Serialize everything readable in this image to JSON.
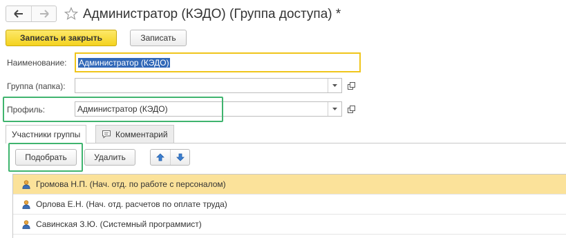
{
  "window": {
    "title": "Администратор (КЭДО) (Группа доступа) *"
  },
  "toolbar": {
    "save_close_label": "Записать и закрыть",
    "save_label": "Записать"
  },
  "form": {
    "name_label": "Наименование:",
    "name_value": "Администратор (КЭДО)",
    "group_label": "Группа (папка):",
    "group_value": "",
    "profile_label": "Профиль:",
    "profile_value": "Администратор (КЭДО)"
  },
  "tabs": [
    {
      "label": "Участники группы",
      "active": true
    },
    {
      "label": "Комментарий",
      "active": false
    }
  ],
  "members_toolbar": {
    "pick_label": "Подобрать",
    "delete_label": "Удалить"
  },
  "members": [
    {
      "name": "Громова Н.П. (Нач. отд. по работе с персоналом)",
      "selected": true
    },
    {
      "name": "Орлова Е.Н. (Нач. отд. расчетов по оплате труда)",
      "selected": false
    },
    {
      "name": "Савинская З.Ю. (Системный программист)",
      "selected": false
    }
  ],
  "colors": {
    "primary_button": "#f4d21f",
    "highlight_frame": "#3fb46e",
    "selected_row": "#fbe29a",
    "selection": "#3168b8"
  }
}
